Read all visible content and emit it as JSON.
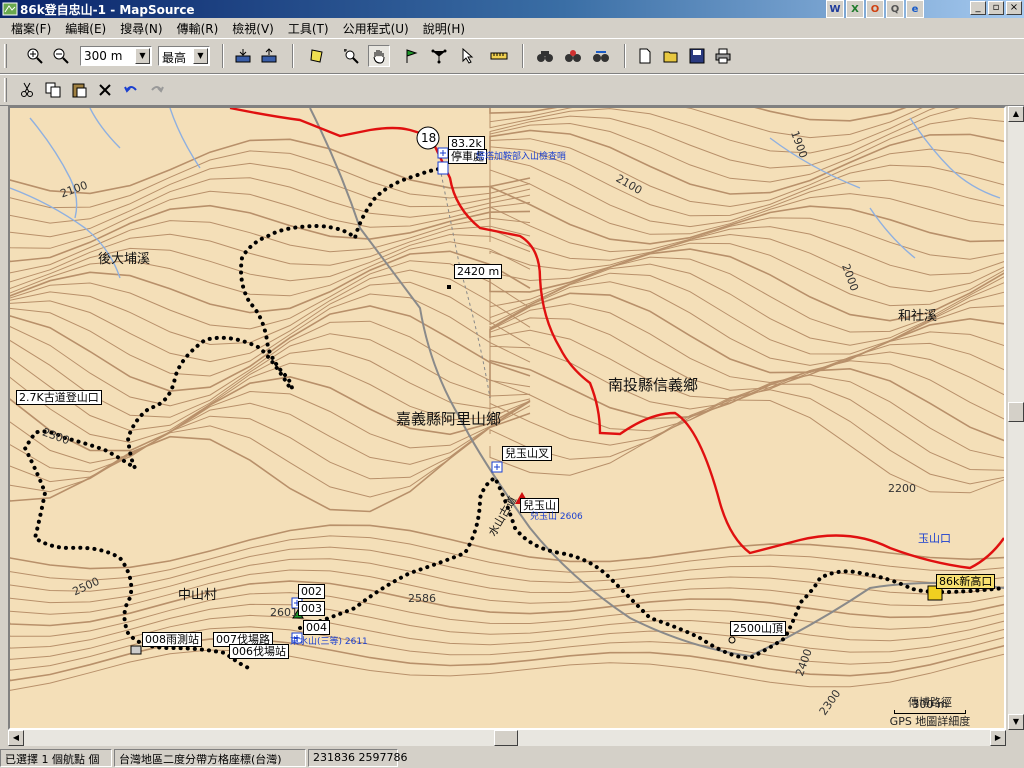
{
  "window": {
    "title": "86k登自忠山-1 - MapSource",
    "tray": [
      "W",
      "X",
      "O",
      "Q",
      "e"
    ],
    "buttons": [
      "_",
      "▫",
      "×"
    ]
  },
  "menu": [
    "檔案(F)",
    "編輯(E)",
    "搜尋(N)",
    "傳輸(R)",
    "檢視(V)",
    "工具(T)",
    "公用程式(U)",
    "說明(H)"
  ],
  "toolbar": {
    "zoom_value": "300 m",
    "detail_value": "最高",
    "icons": [
      "zoom-in-icon",
      "zoom-out-icon",
      "receive-from-device-icon",
      "send-to-device-icon",
      "select-map-icon",
      "zoom-tool-icon",
      "hand-tool-icon",
      "waypoint-tool-icon",
      "route-tool-icon",
      "pointer-tool-icon",
      "measure-tool-icon",
      "find-icon",
      "find-nearest-icon",
      "find-places-icon",
      "new-file-icon",
      "open-file-icon",
      "save-file-icon",
      "print-icon"
    ],
    "edit_icons": [
      "cut-icon",
      "copy-icon",
      "paste-icon",
      "delete-icon",
      "undo-icon",
      "redo-icon"
    ]
  },
  "map": {
    "area_labels": [
      "嘉義縣阿里山鄉",
      "南投縣信義鄉"
    ],
    "place_labels": [
      "後大埔溪",
      "和社溪",
      "中山村",
      "玉山口"
    ],
    "contours": [
      "2100",
      "2100",
      "1900",
      "2000",
      "2200",
      "2300",
      "2500",
      "2400",
      "2300",
      "2586",
      "2601"
    ],
    "waypoints": {
      "wp_2_7k": "2.7K古道登山口",
      "wp_83_2k": "83.2k",
      "wp_parking": "停車處",
      "wp_checkpoint": "塔塔加鞍部入山檢查哨",
      "wp_2420": "2420 m",
      "wp_route18": "18",
      "wp_doerfork": "兒玉山叉",
      "wp_doer": "兒玉山",
      "wp_doer_ele": "兒玉山 2606",
      "wp_002": "002",
      "wp_003": "003",
      "wp_004": "004",
      "wp_004_label": "東水山(三等) 2611",
      "wp_008": "008雨測站",
      "wp_007": "007伐場路",
      "wp_006": "006伐場站",
      "wp_2500": "2500山頂",
      "wp_86k": "86k新高口",
      "wp_mountain_road": "水山古道"
    },
    "scale_text": "300 m",
    "scale_caption": "傳博路徑",
    "detail_caption": "GPS 地圖詳細度"
  },
  "status": {
    "selection": "已選擇 1 個航點 個",
    "grid": "台灣地區二度分帶方格座標(台灣)",
    "coords": "231836 2597786"
  }
}
